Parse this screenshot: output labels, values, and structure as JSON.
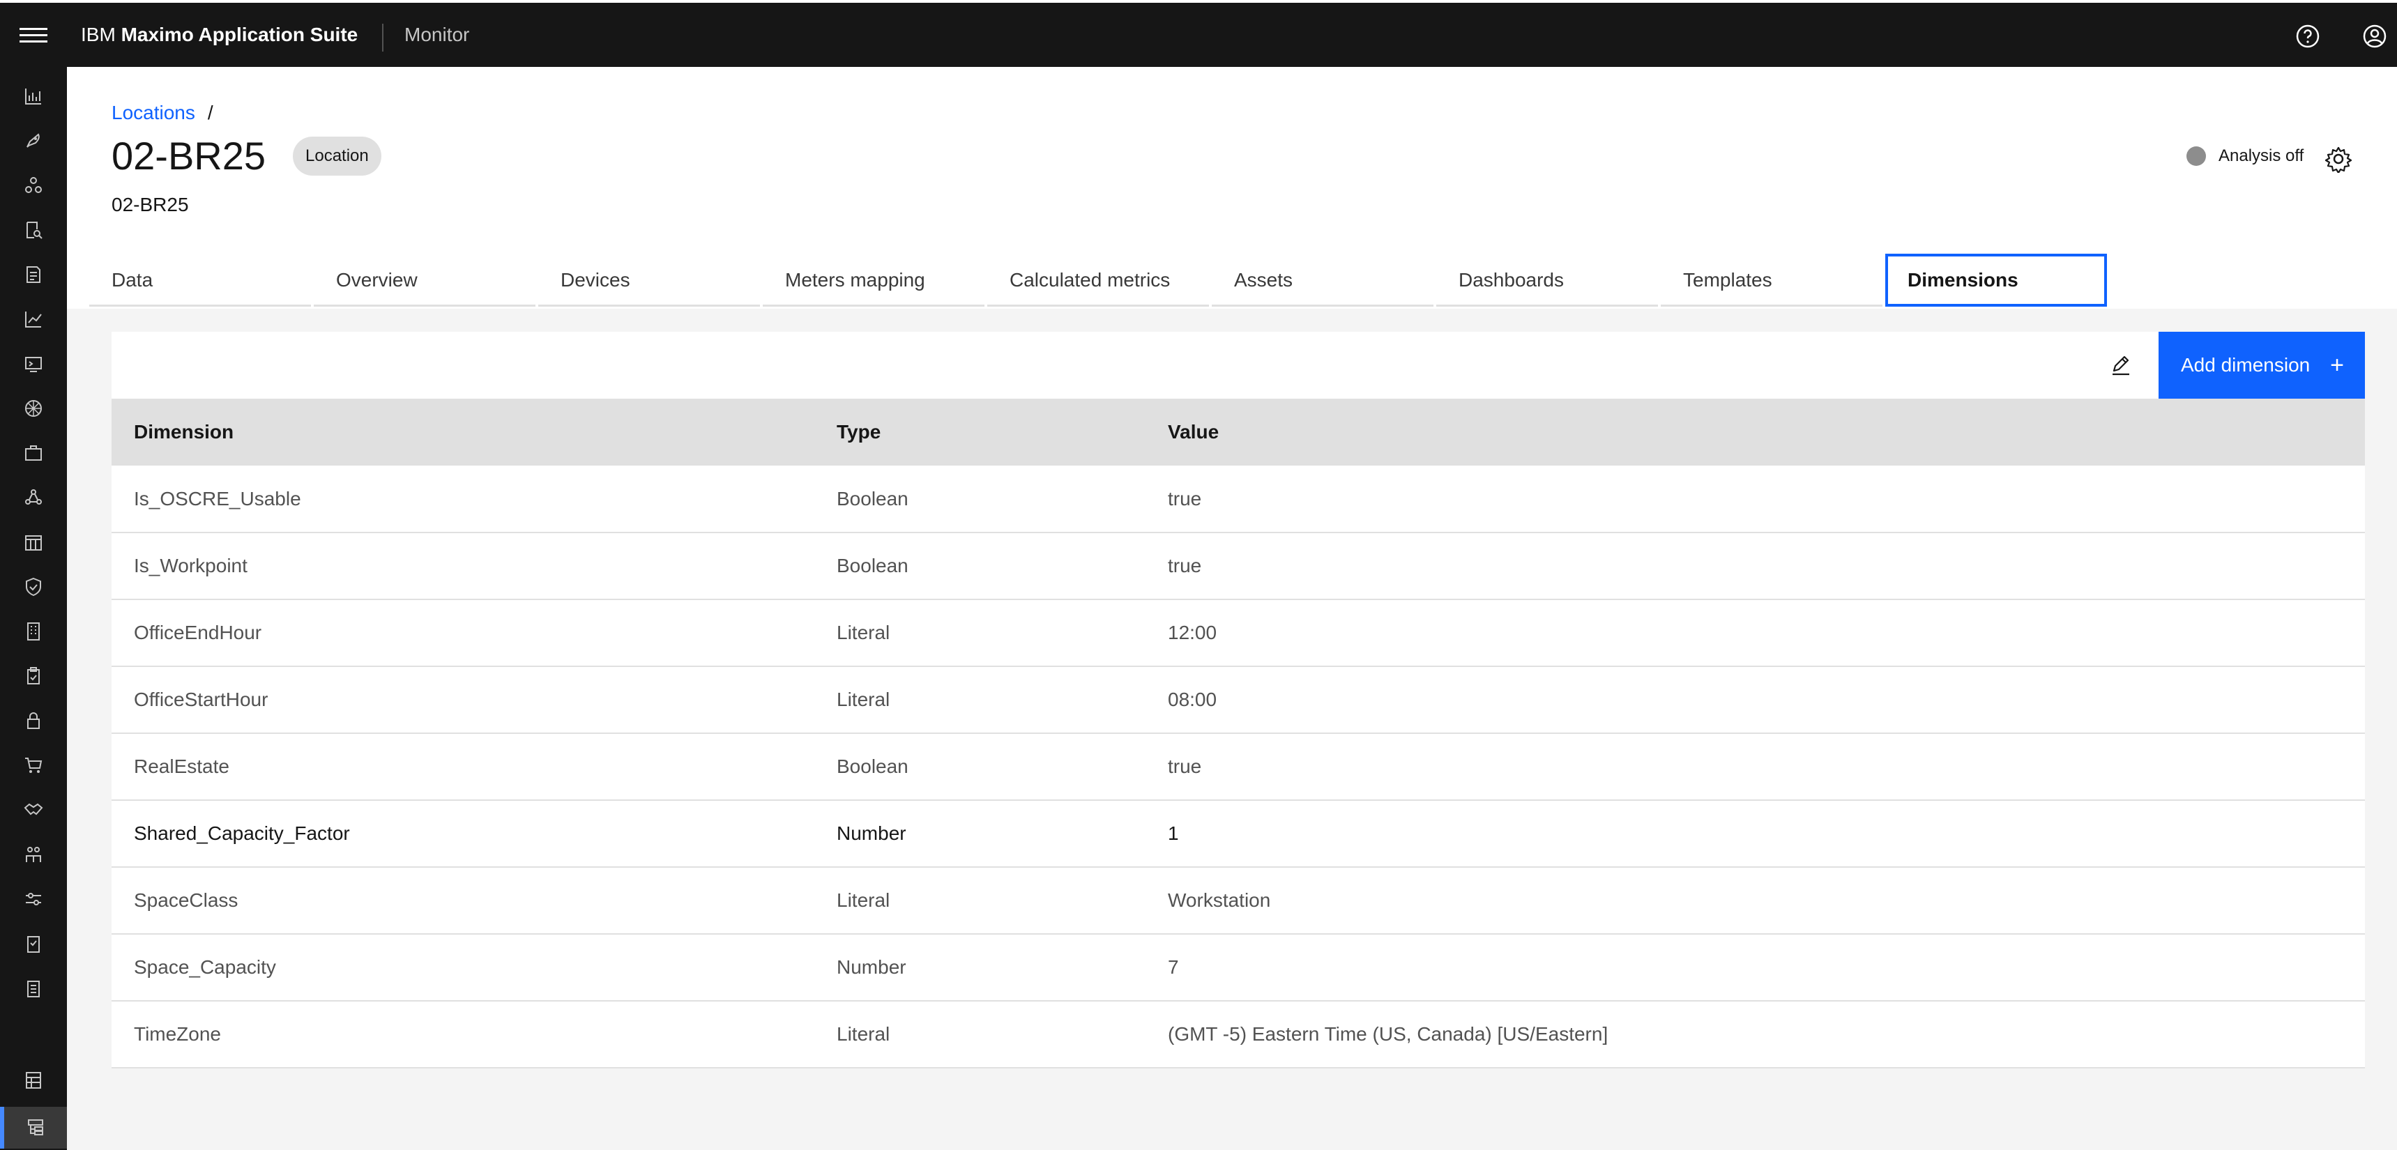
{
  "header": {
    "brand_prefix": "IBM",
    "brand_name": "Maximo Application Suite",
    "app_name": "Monitor",
    "icons": [
      "menu-icon",
      "help-icon",
      "user-profile-icon"
    ]
  },
  "sidenav": {
    "icons": [
      "bar-chart-icon",
      "rocket-icon",
      "network-icon",
      "search-doc-icon",
      "report-icon",
      "line-chart-icon",
      "monitor-icon",
      "wheel-icon",
      "briefcase-icon",
      "nodes-icon",
      "calendar-grid-icon",
      "shield-check-icon",
      "building-icon",
      "clipboard-icon",
      "lock-icon",
      "cart-icon",
      "handshake-icon",
      "people-icon",
      "sliders-icon",
      "checklist-icon",
      "list-doc-icon",
      "calculator-icon",
      "hierarchy-icon"
    ]
  },
  "breadcrumb": {
    "link": "Locations",
    "separator": "/"
  },
  "page": {
    "title": "02-BR25",
    "tag": "Location",
    "subtitle": "02-BR25"
  },
  "analysis": {
    "label": "Analysis off",
    "status_color": "#8d8d8d"
  },
  "tabs": [
    {
      "label": "Data"
    },
    {
      "label": "Overview"
    },
    {
      "label": "Devices"
    },
    {
      "label": "Meters mapping"
    },
    {
      "label": "Calculated metrics"
    },
    {
      "label": "Assets"
    },
    {
      "label": "Dashboards"
    },
    {
      "label": "Templates"
    },
    {
      "label": "Dimensions",
      "selected": true
    }
  ],
  "toolbar": {
    "add_label": "Add dimension",
    "add_icon": "+"
  },
  "table": {
    "headers": [
      "Dimension",
      "Type",
      "Value"
    ],
    "rows": [
      [
        "Is_OSCRE_Usable",
        "Boolean",
        "true"
      ],
      [
        "Is_Workpoint",
        "Boolean",
        "true"
      ],
      [
        "OfficeEndHour",
        "Literal",
        "12:00"
      ],
      [
        "OfficeStartHour",
        "Literal",
        "08:00"
      ],
      [
        "RealEstate",
        "Boolean",
        "true"
      ],
      [
        "Shared_Capacity_Factor",
        "Number",
        "1"
      ],
      [
        "SpaceClass",
        "Literal",
        "Workstation"
      ],
      [
        "Space_Capacity",
        "Number",
        "7"
      ],
      [
        "TimeZone",
        "Literal",
        "(GMT -5) Eastern Time (US, Canada) [US/Eastern]"
      ]
    ]
  },
  "colors": {
    "accent": "#0f62fe",
    "header_bg": "#161616"
  }
}
